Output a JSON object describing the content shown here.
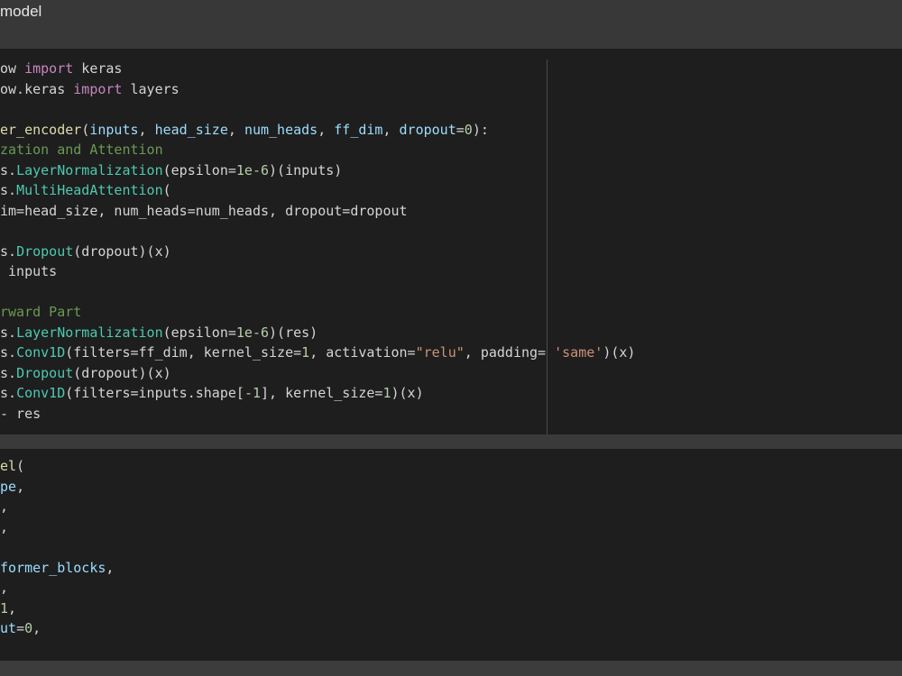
{
  "header": {
    "title": "model"
  },
  "cells": [
    {
      "lines": [
        [
          {
            "t": "ow ",
            "c": "txt"
          },
          {
            "t": "import",
            "c": "kw"
          },
          {
            "t": " keras",
            "c": "txt"
          }
        ],
        [
          {
            "t": "ow.keras ",
            "c": "txt"
          },
          {
            "t": "import",
            "c": "kw"
          },
          {
            "t": " layers",
            "c": "txt"
          }
        ],
        [],
        [
          {
            "t": "er_encoder",
            "c": "fn"
          },
          {
            "t": "(",
            "c": "txt"
          },
          {
            "t": "inputs",
            "c": "pr"
          },
          {
            "t": ", ",
            "c": "txt"
          },
          {
            "t": "head_size",
            "c": "pr"
          },
          {
            "t": ", ",
            "c": "txt"
          },
          {
            "t": "num_heads",
            "c": "pr"
          },
          {
            "t": ", ",
            "c": "txt"
          },
          {
            "t": "ff_dim",
            "c": "pr"
          },
          {
            "t": ", ",
            "c": "txt"
          },
          {
            "t": "dropout",
            "c": "pr"
          },
          {
            "t": "=",
            "c": "txt"
          },
          {
            "t": "0",
            "c": "num"
          },
          {
            "t": "):",
            "c": "txt"
          }
        ],
        [
          {
            "t": "zation and Attention",
            "c": "com"
          }
        ],
        [
          {
            "t": "s.",
            "c": "txt"
          },
          {
            "t": "LayerNormalization",
            "c": "ty"
          },
          {
            "t": "(epsilon=",
            "c": "txt"
          },
          {
            "t": "1e-6",
            "c": "num"
          },
          {
            "t": ")(inputs)",
            "c": "txt"
          }
        ],
        [
          {
            "t": "s.",
            "c": "txt"
          },
          {
            "t": "MultiHeadAttention",
            "c": "ty"
          },
          {
            "t": "(",
            "c": "txt"
          }
        ],
        [
          {
            "t": "im=head_size, num_heads=num_heads, dropout=dropout",
            "c": "txt"
          }
        ],
        [],
        [
          {
            "t": "s.",
            "c": "txt"
          },
          {
            "t": "Dropout",
            "c": "ty"
          },
          {
            "t": "(dropout)(x)",
            "c": "txt"
          }
        ],
        [
          {
            "t": " inputs",
            "c": "txt"
          }
        ],
        [],
        [
          {
            "t": "rward Part",
            "c": "com"
          }
        ],
        [
          {
            "t": "s.",
            "c": "txt"
          },
          {
            "t": "LayerNormalization",
            "c": "ty"
          },
          {
            "t": "(epsilon=",
            "c": "txt"
          },
          {
            "t": "1e-6",
            "c": "num"
          },
          {
            "t": ")(res)",
            "c": "txt"
          }
        ],
        [
          {
            "t": "s.",
            "c": "txt"
          },
          {
            "t": "Conv1D",
            "c": "ty"
          },
          {
            "t": "(filters=ff_dim, kernel_size=",
            "c": "txt"
          },
          {
            "t": "1",
            "c": "num"
          },
          {
            "t": ", activation=",
            "c": "txt"
          },
          {
            "t": "\"relu\"",
            "c": "str"
          },
          {
            "t": ", padding= ",
            "c": "txt"
          },
          {
            "t": "'same'",
            "c": "str"
          },
          {
            "t": ")(x)",
            "c": "txt"
          }
        ],
        [
          {
            "t": "s.",
            "c": "txt"
          },
          {
            "t": "Dropout",
            "c": "ty"
          },
          {
            "t": "(dropout)(x)",
            "c": "txt"
          }
        ],
        [
          {
            "t": "s.",
            "c": "txt"
          },
          {
            "t": "Conv1D",
            "c": "ty"
          },
          {
            "t": "(filters=inputs.shape[",
            "c": "txt"
          },
          {
            "t": "-1",
            "c": "num"
          },
          {
            "t": "], kernel_size=",
            "c": "txt"
          },
          {
            "t": "1",
            "c": "num"
          },
          {
            "t": ")(x)",
            "c": "txt"
          }
        ],
        [
          {
            "t": "- res",
            "c": "txt"
          }
        ]
      ]
    },
    {
      "lines": [
        [
          {
            "t": "el",
            "c": "fn"
          },
          {
            "t": "(",
            "c": "txt"
          }
        ],
        [
          {
            "t": "pe",
            "c": "pr"
          },
          {
            "t": ",",
            "c": "txt"
          }
        ],
        [
          {
            "t": ",",
            "c": "txt"
          }
        ],
        [
          {
            "t": ",",
            "c": "txt"
          }
        ],
        [],
        [
          {
            "t": "former_blocks",
            "c": "pr"
          },
          {
            "t": ",",
            "c": "txt"
          }
        ],
        [
          {
            "t": ",",
            "c": "txt"
          }
        ],
        [
          {
            "t": "1",
            "c": "num"
          },
          {
            "t": ",",
            "c": "txt"
          }
        ],
        [
          {
            "t": "ut",
            "c": "pr"
          },
          {
            "t": "=",
            "c": "txt"
          },
          {
            "t": "0",
            "c": "num"
          },
          {
            "t": ",",
            "c": "txt"
          }
        ]
      ]
    }
  ]
}
